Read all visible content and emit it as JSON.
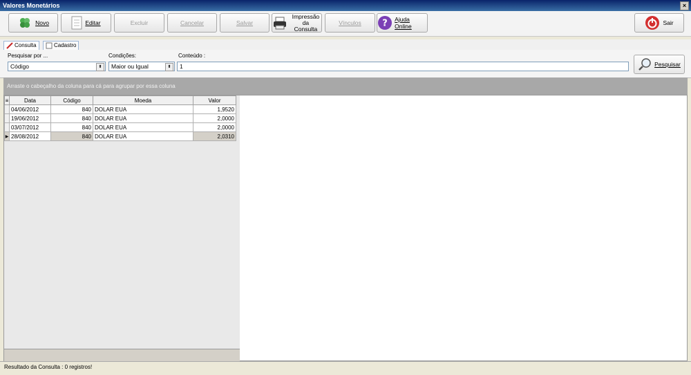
{
  "window": {
    "title": "Valores Monetários",
    "close_label": "×"
  },
  "toolbar": {
    "novo": "Novo",
    "editar": "Editar",
    "excluir": "Excluir",
    "cancelar": "Cancelar",
    "salvar": "Salvar",
    "impressao_1": "Impressão",
    "impressao_2": "da Consulta",
    "vinculos": "Vínculos",
    "ajuda": "Ajuda Online",
    "sair": "Sair"
  },
  "tabs": [
    {
      "label": "Consulta"
    },
    {
      "label": "Cadastro"
    }
  ],
  "search": {
    "pesquisar_por_label": "Pesquisar por ...",
    "pesquisar_por_value": "Código",
    "condicoes_label": "Condições:",
    "condicoes_value": "Maior ou Igual",
    "conteudo_label": "Conteúdo :",
    "conteudo_value": "1",
    "button": "Pesquisar"
  },
  "group_hint": "Arraste o cabeçalho da coluna para cá para agrupar por essa coluna",
  "grid": {
    "headers": {
      "data": "Data",
      "codigo": "Código",
      "moeda": "Moeda",
      "valor": "Valor"
    },
    "rows": [
      {
        "data": "04/06/2012",
        "codigo": "840",
        "moeda": "DOLAR EUA",
        "valor": "1,9520"
      },
      {
        "data": "19/06/2012",
        "codigo": "840",
        "moeda": "DOLAR EUA",
        "valor": "2,0000"
      },
      {
        "data": "03/07/2012",
        "codigo": "840",
        "moeda": "DOLAR EUA",
        "valor": "2,0000"
      },
      {
        "data": "28/08/2012",
        "codigo": "840",
        "moeda": "DOLAR EUA",
        "valor": "2,0310"
      }
    ]
  },
  "status": "Resultado da Consulta : 0 registros!"
}
